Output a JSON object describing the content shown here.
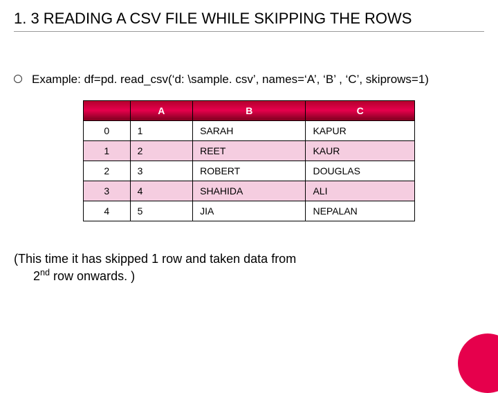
{
  "title_prefix": "1. 3 R",
  "title_rest": "EADING A CSV FILE WHILE SKIPPING THE ROWS",
  "bullet": "Example: df=pd. read_csv(‘d: \\sample. csv’, names=‘A’, ‘B’ , ‘C’, skiprows=1)",
  "headers": [
    "",
    "A",
    "B",
    "C"
  ],
  "rows": [
    [
      "0",
      "1",
      "SARAH",
      "KAPUR"
    ],
    [
      "1",
      "2",
      "REET",
      "KAUR"
    ],
    [
      "2",
      "3",
      "ROBERT",
      "DOUGLAS"
    ],
    [
      "3",
      "4",
      "SHAHIDA",
      "ALI"
    ],
    [
      "4",
      "5",
      "JIA",
      "NEPALAN"
    ]
  ],
  "footnote_line1": "(This time it has skipped 1 row and taken data from",
  "footnote_line2_pre": "2",
  "footnote_line2_sup": "nd",
  "footnote_line2_post": " row onwards. )"
}
